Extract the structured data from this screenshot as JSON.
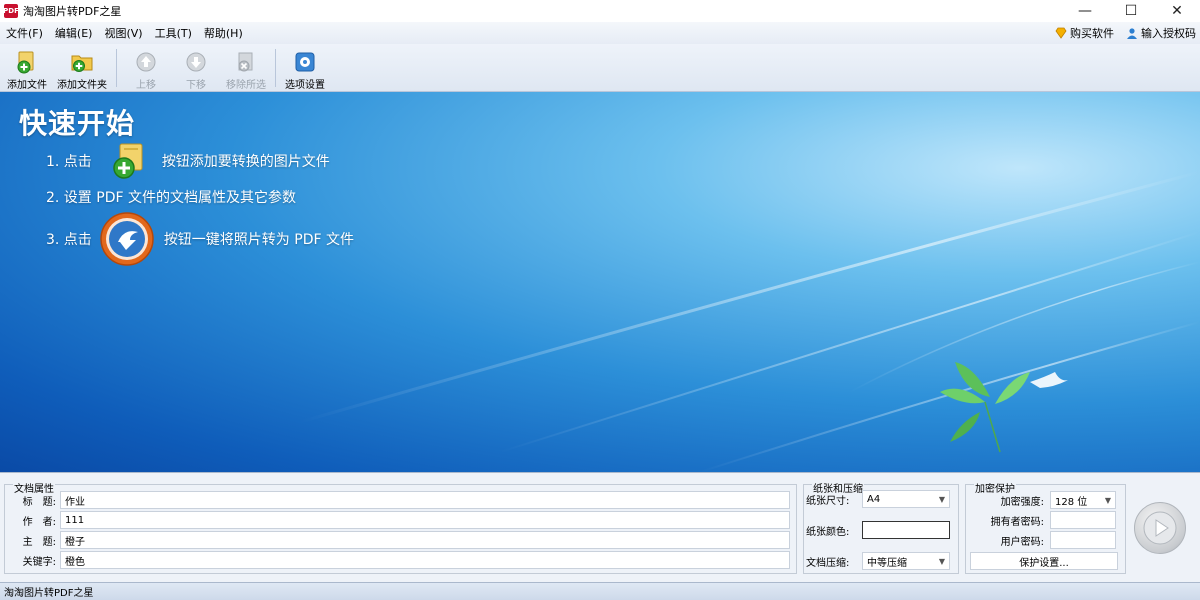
{
  "window": {
    "title": "淘淘图片转PDF之星",
    "icon_text": "PDF"
  },
  "menu": {
    "items": [
      "文件(F)",
      "编辑(E)",
      "视图(V)",
      "工具(T)",
      "帮助(H)"
    ],
    "buy": "购买软件",
    "license": "输入授权码"
  },
  "toolbar": {
    "add_file": "添加文件",
    "add_folder": "添加文件夹",
    "move_up": "上移",
    "move_down": "下移",
    "remove_selected": "移除所选",
    "options": "选项设置"
  },
  "quickstart": {
    "title": "快速开始",
    "step1_prefix": "1. 点击",
    "step1_suffix": "按钮添加要转换的图片文件",
    "step2": "2. 设置 PDF 文件的文档属性及其它参数",
    "step3_prefix": "3. 点击",
    "step3_suffix": "按钮一键将照片转为 PDF 文件"
  },
  "doc_props": {
    "title": "文档属性",
    "title_label": "标　题:",
    "title_value": "作业",
    "author_label": "作　者:",
    "author_value": "111",
    "subject_label": "主　题:",
    "subject_value": "橙子",
    "keywords_label": "关键字:",
    "keywords_value": "橙色"
  },
  "paper": {
    "title": "纸张和压缩",
    "size_label": "纸张尺寸:",
    "size_value": "A4",
    "color_label": "纸张颜色:",
    "compress_label": "文档压缩:",
    "compress_value": "中等压缩"
  },
  "security": {
    "title": "加密保护",
    "strength_label": "加密强度:",
    "strength_value": "128 位",
    "owner_pwd_label": "拥有者密码:",
    "user_pwd_label": "用户密码:",
    "settings_button": "保护设置..."
  },
  "statusbar": {
    "text": "淘淘图片转PDF之星"
  }
}
